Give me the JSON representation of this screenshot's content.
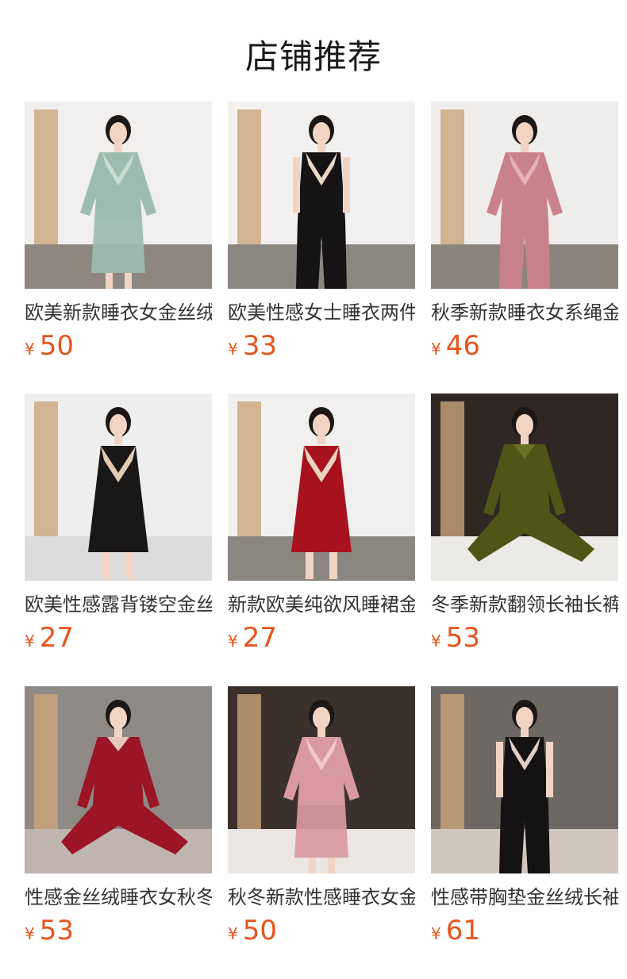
{
  "shop": {
    "title": "店铺推荐"
  },
  "products": [
    {
      "name": "欧美新款睡衣女金丝绒",
      "currency": "¥",
      "price": "50",
      "wall": "#f0efed",
      "floor": "#8d8780",
      "garment": "#9dbcb0",
      "accent": "#c9dbd2",
      "style": "robe"
    },
    {
      "name": "欧美性感女士睡衣两件",
      "currency": "¥",
      "price": "33",
      "wall": "#f2f1ef",
      "floor": "#8b8680",
      "garment": "#151313",
      "accent": "#e8d9c7",
      "style": "cami-pants"
    },
    {
      "name": "秋季新款睡衣女系绳金",
      "currency": "¥",
      "price": "46",
      "wall": "#efedeb",
      "floor": "#8a847d",
      "garment": "#c9828a",
      "accent": "#e3b3b8",
      "style": "longsleeve"
    },
    {
      "name": "欧美性感露背镂空金丝",
      "currency": "¥",
      "price": "27",
      "wall": "#eeeeee",
      "floor": "#dcdcdc",
      "garment": "#1a1717",
      "accent": "#e2c9b0",
      "style": "dress"
    },
    {
      "name": "新款欧美纯欲风睡裙金",
      "currency": "¥",
      "price": "27",
      "wall": "#f1f0ee",
      "floor": "#8c8680",
      "garment": "#a8121f",
      "accent": "#ead3c0",
      "style": "dress"
    },
    {
      "name": "冬季新款翻领长袖长裤",
      "currency": "¥",
      "price": "53",
      "wall": "#2f2724",
      "floor": "#eceae6",
      "garment": "#4f5516",
      "accent": "#6c7224",
      "style": "sitting"
    },
    {
      "name": "性感金丝绒睡衣女秋冬",
      "currency": "¥",
      "price": "53",
      "wall": "#8f8a86",
      "floor": "#bfb5ae",
      "garment": "#9b1526",
      "accent": "#e7c8bd",
      "style": "sitting"
    },
    {
      "name": "秋冬新款性感睡衣女金",
      "currency": "¥",
      "price": "50",
      "wall": "#3a302c",
      "floor": "#ece6e2",
      "garment": "#d89aa0",
      "accent": "#f0c9cc",
      "style": "robe"
    },
    {
      "name": "性感带胸垫金丝绒长袖",
      "currency": "¥",
      "price": "61",
      "wall": "#6d6863",
      "floor": "#cfc7bd",
      "garment": "#141212",
      "accent": "#ddd0c2",
      "style": "cami-pants"
    }
  ]
}
